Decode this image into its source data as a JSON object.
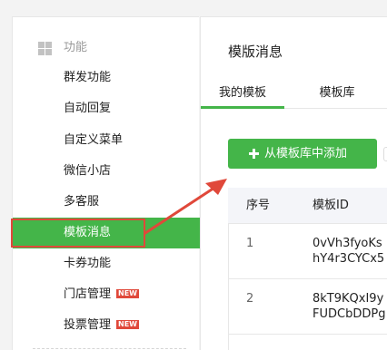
{
  "sidebar": {
    "section_title": "功能",
    "items": [
      {
        "label": "群发功能"
      },
      {
        "label": "自动回复"
      },
      {
        "label": "自定义菜单"
      },
      {
        "label": "微信小店"
      },
      {
        "label": "多客服"
      },
      {
        "label": "模板消息",
        "active": true
      },
      {
        "label": "卡券功能"
      },
      {
        "label": "门店管理",
        "badge": "NEW"
      },
      {
        "label": "投票管理",
        "badge": "NEW"
      }
    ]
  },
  "main": {
    "title": "模版消息",
    "tabs": [
      {
        "label": "我的模板",
        "active": true
      },
      {
        "label": "模板库"
      }
    ],
    "add_button_label": "从模板库中添加",
    "table": {
      "columns": [
        "序号",
        "模板ID"
      ],
      "rows": [
        {
          "no": "1",
          "id_line1": "0vVh3fyoKs",
          "id_line2": "hY4r3CYCx5"
        },
        {
          "no": "2",
          "id_line1": "8kT9KQxI9y",
          "id_line2": "FUDCbDDPg"
        }
      ]
    }
  },
  "colors": {
    "accent": "#44b549",
    "highlight": "#e0483a"
  }
}
